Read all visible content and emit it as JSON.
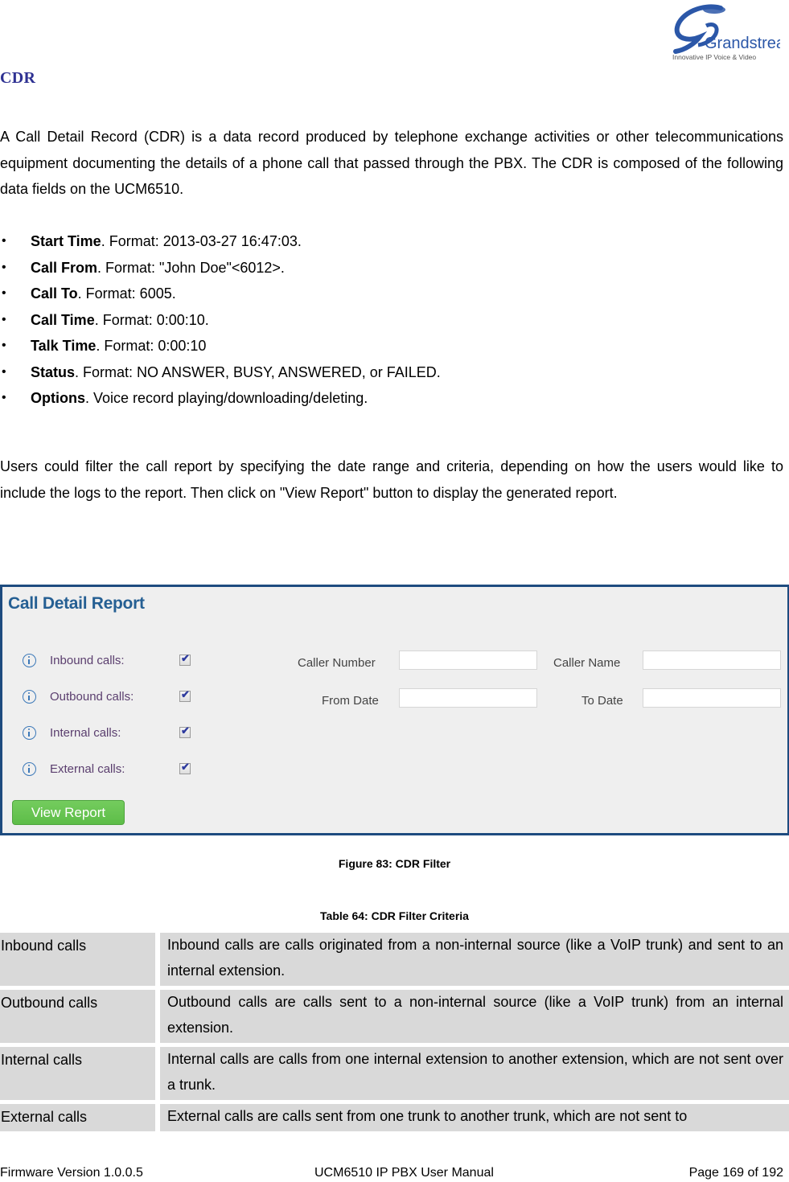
{
  "header": {
    "logo_text": "Grandstream",
    "logo_tagline": "Innovative IP Voice & Video",
    "logo_color": "#2b57a8"
  },
  "section": {
    "title": "CDR",
    "title_color": "#2e3192",
    "intro": "A Call Detail Record (CDR) is a data record produced by telephone exchange activities or other telecommunications equipment documenting the details of a phone call that passed through the PBX. The CDR is composed of the following data fields on the UCM6510.",
    "fields": [
      {
        "name": "Start Time",
        "desc": ". Format: 2013-03-27 16:47:03."
      },
      {
        "name": "Call From",
        "desc": ". Format: \"John Doe\"<6012>."
      },
      {
        "name": "Call To",
        "desc": ". Format: 6005."
      },
      {
        "name": "Call Time",
        "desc": ". Format: 0:00:10."
      },
      {
        "name": "Talk Time",
        "desc": ". Format: 0:00:10"
      },
      {
        "name": "Status",
        "desc": ". Format: NO ANSWER, BUSY, ANSWERED, or FAILED."
      },
      {
        "name": "Options",
        "desc": ". Voice record playing/downloading/deleting."
      }
    ],
    "filter_text": "Users could filter the call report by specifying the date range and criteria, depending on how the users would like to include the logs to the report. Then click on \"View Report\" button to display the generated report."
  },
  "cdr_panel": {
    "title": "Call Detail Report",
    "title_color": "#255f93",
    "frame_color": "#1d4b7f",
    "filters": [
      {
        "label": "Inbound calls:",
        "checked": true
      },
      {
        "label": "Outbound calls:",
        "checked": true
      },
      {
        "label": "Internal calls:",
        "checked": true
      },
      {
        "label": "External calls:",
        "checked": true
      }
    ],
    "check_glyph": "✔",
    "fields": {
      "caller_number": {
        "label": "Caller Number",
        "value": ""
      },
      "caller_name": {
        "label": "Caller Name",
        "value": ""
      },
      "from_date": {
        "label": "From Date",
        "value": ""
      },
      "to_date": {
        "label": "To Date",
        "value": ""
      }
    },
    "view_report_label": "View Report",
    "button_color": "#5dbd48"
  },
  "figure_caption": "Figure 83: CDR Filter",
  "table": {
    "caption": "Table 64: CDR Filter Criteria",
    "rows": [
      {
        "key": "Inbound calls",
        "value": "Inbound calls are calls originated from a non-internal source (like a VoIP trunk) and sent to an internal extension."
      },
      {
        "key": "Outbound calls",
        "value": "Outbound calls are calls sent to a non-internal source (like a VoIP trunk) from an internal extension."
      },
      {
        "key": "Internal calls",
        "value": "Internal calls are calls from one internal extension to another extension, which are not sent over a trunk."
      },
      {
        "key": "External calls",
        "value": "External calls are calls sent from one trunk to another trunk, which are not sent to"
      }
    ]
  },
  "footer": {
    "firmware": "Firmware Version 1.0.0.5",
    "manual": "UCM6510 IP PBX User Manual",
    "page": "Page 169 of 192"
  }
}
